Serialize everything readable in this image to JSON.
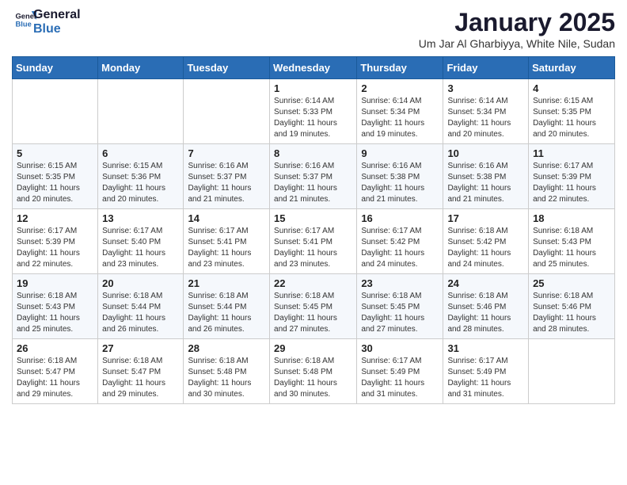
{
  "header": {
    "logo_line1": "General",
    "logo_line2": "Blue",
    "title": "January 2025",
    "subtitle": "Um Jar Al Gharbiyya, White Nile, Sudan"
  },
  "days_of_week": [
    "Sunday",
    "Monday",
    "Tuesday",
    "Wednesday",
    "Thursday",
    "Friday",
    "Saturday"
  ],
  "weeks": [
    [
      {
        "day": "",
        "info": ""
      },
      {
        "day": "",
        "info": ""
      },
      {
        "day": "",
        "info": ""
      },
      {
        "day": "1",
        "info": "Sunrise: 6:14 AM\nSunset: 5:33 PM\nDaylight: 11 hours and 19 minutes."
      },
      {
        "day": "2",
        "info": "Sunrise: 6:14 AM\nSunset: 5:34 PM\nDaylight: 11 hours and 19 minutes."
      },
      {
        "day": "3",
        "info": "Sunrise: 6:14 AM\nSunset: 5:34 PM\nDaylight: 11 hours and 20 minutes."
      },
      {
        "day": "4",
        "info": "Sunrise: 6:15 AM\nSunset: 5:35 PM\nDaylight: 11 hours and 20 minutes."
      }
    ],
    [
      {
        "day": "5",
        "info": "Sunrise: 6:15 AM\nSunset: 5:35 PM\nDaylight: 11 hours and 20 minutes."
      },
      {
        "day": "6",
        "info": "Sunrise: 6:15 AM\nSunset: 5:36 PM\nDaylight: 11 hours and 20 minutes."
      },
      {
        "day": "7",
        "info": "Sunrise: 6:16 AM\nSunset: 5:37 PM\nDaylight: 11 hours and 21 minutes."
      },
      {
        "day": "8",
        "info": "Sunrise: 6:16 AM\nSunset: 5:37 PM\nDaylight: 11 hours and 21 minutes."
      },
      {
        "day": "9",
        "info": "Sunrise: 6:16 AM\nSunset: 5:38 PM\nDaylight: 11 hours and 21 minutes."
      },
      {
        "day": "10",
        "info": "Sunrise: 6:16 AM\nSunset: 5:38 PM\nDaylight: 11 hours and 21 minutes."
      },
      {
        "day": "11",
        "info": "Sunrise: 6:17 AM\nSunset: 5:39 PM\nDaylight: 11 hours and 22 minutes."
      }
    ],
    [
      {
        "day": "12",
        "info": "Sunrise: 6:17 AM\nSunset: 5:39 PM\nDaylight: 11 hours and 22 minutes."
      },
      {
        "day": "13",
        "info": "Sunrise: 6:17 AM\nSunset: 5:40 PM\nDaylight: 11 hours and 23 minutes."
      },
      {
        "day": "14",
        "info": "Sunrise: 6:17 AM\nSunset: 5:41 PM\nDaylight: 11 hours and 23 minutes."
      },
      {
        "day": "15",
        "info": "Sunrise: 6:17 AM\nSunset: 5:41 PM\nDaylight: 11 hours and 23 minutes."
      },
      {
        "day": "16",
        "info": "Sunrise: 6:17 AM\nSunset: 5:42 PM\nDaylight: 11 hours and 24 minutes."
      },
      {
        "day": "17",
        "info": "Sunrise: 6:18 AM\nSunset: 5:42 PM\nDaylight: 11 hours and 24 minutes."
      },
      {
        "day": "18",
        "info": "Sunrise: 6:18 AM\nSunset: 5:43 PM\nDaylight: 11 hours and 25 minutes."
      }
    ],
    [
      {
        "day": "19",
        "info": "Sunrise: 6:18 AM\nSunset: 5:43 PM\nDaylight: 11 hours and 25 minutes."
      },
      {
        "day": "20",
        "info": "Sunrise: 6:18 AM\nSunset: 5:44 PM\nDaylight: 11 hours and 26 minutes."
      },
      {
        "day": "21",
        "info": "Sunrise: 6:18 AM\nSunset: 5:44 PM\nDaylight: 11 hours and 26 minutes."
      },
      {
        "day": "22",
        "info": "Sunrise: 6:18 AM\nSunset: 5:45 PM\nDaylight: 11 hours and 27 minutes."
      },
      {
        "day": "23",
        "info": "Sunrise: 6:18 AM\nSunset: 5:45 PM\nDaylight: 11 hours and 27 minutes."
      },
      {
        "day": "24",
        "info": "Sunrise: 6:18 AM\nSunset: 5:46 PM\nDaylight: 11 hours and 28 minutes."
      },
      {
        "day": "25",
        "info": "Sunrise: 6:18 AM\nSunset: 5:46 PM\nDaylight: 11 hours and 28 minutes."
      }
    ],
    [
      {
        "day": "26",
        "info": "Sunrise: 6:18 AM\nSunset: 5:47 PM\nDaylight: 11 hours and 29 minutes."
      },
      {
        "day": "27",
        "info": "Sunrise: 6:18 AM\nSunset: 5:47 PM\nDaylight: 11 hours and 29 minutes."
      },
      {
        "day": "28",
        "info": "Sunrise: 6:18 AM\nSunset: 5:48 PM\nDaylight: 11 hours and 30 minutes."
      },
      {
        "day": "29",
        "info": "Sunrise: 6:18 AM\nSunset: 5:48 PM\nDaylight: 11 hours and 30 minutes."
      },
      {
        "day": "30",
        "info": "Sunrise: 6:17 AM\nSunset: 5:49 PM\nDaylight: 11 hours and 31 minutes."
      },
      {
        "day": "31",
        "info": "Sunrise: 6:17 AM\nSunset: 5:49 PM\nDaylight: 11 hours and 31 minutes."
      },
      {
        "day": "",
        "info": ""
      }
    ]
  ]
}
